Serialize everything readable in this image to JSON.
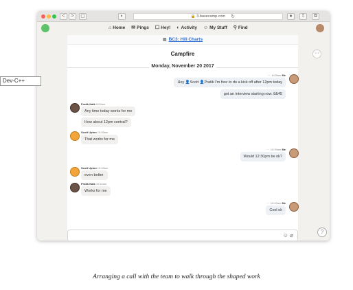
{
  "browser": {
    "url": "3.basecamp.com",
    "buttons": [
      "<",
      ">",
      "▢"
    ]
  },
  "nav": {
    "items": [
      {
        "icon": "home-icon",
        "glyph": "⌂",
        "label": "Home"
      },
      {
        "icon": "pings-icon",
        "glyph": "✉",
        "label": "Pings"
      },
      {
        "icon": "hey-icon",
        "glyph": "☐",
        "label": "Hey!"
      },
      {
        "icon": "activity-icon",
        "glyph": "◐",
        "label": "Activity"
      },
      {
        "icon": "mystuff-icon",
        "glyph": "☺",
        "label": "My Stuff"
      },
      {
        "icon": "find-icon",
        "glyph": "⚲",
        "label": "Find"
      }
    ]
  },
  "breadcrumb": "BC3: Hill Charts",
  "campfire": {
    "title": "Campfire",
    "date": "Monday, November 20 2017",
    "messages": [
      {
        "side": "me",
        "time": "8:08am",
        "author": "Me",
        "text": "Hey 👤Scott 👤Pratik I'm free to do a kick off after 12pm today"
      },
      {
        "side": "me",
        "time": "",
        "author": "",
        "text": "got an interview starting now. 8&45"
      },
      {
        "side": "other",
        "time": "8:09am",
        "author": "Pratik Naik",
        "text": "Any time today works for me"
      },
      {
        "side": "other",
        "time": "",
        "author": "",
        "text": "How about 12pm central?"
      },
      {
        "side": "other",
        "time": "10:05am",
        "author": "Scott Upton",
        "text": "That works for me"
      },
      {
        "side": "me",
        "time": "10:39am",
        "author": "Me",
        "text": "Would 12:30pm be ok?"
      },
      {
        "side": "other",
        "time": "10:40am",
        "author": "Scott Upton",
        "text": "even better"
      },
      {
        "side": "other",
        "time": "10:42am",
        "author": "Pratik Naik",
        "text": "Works for me"
      },
      {
        "side": "me",
        "time": "10:42am",
        "author": "Me",
        "text": "Cool ok"
      }
    ]
  },
  "composer": {
    "placeholder": ""
  },
  "ide_label": "Dev-C++",
  "caption": "Arranging a call with the team to walk through the shaped work"
}
